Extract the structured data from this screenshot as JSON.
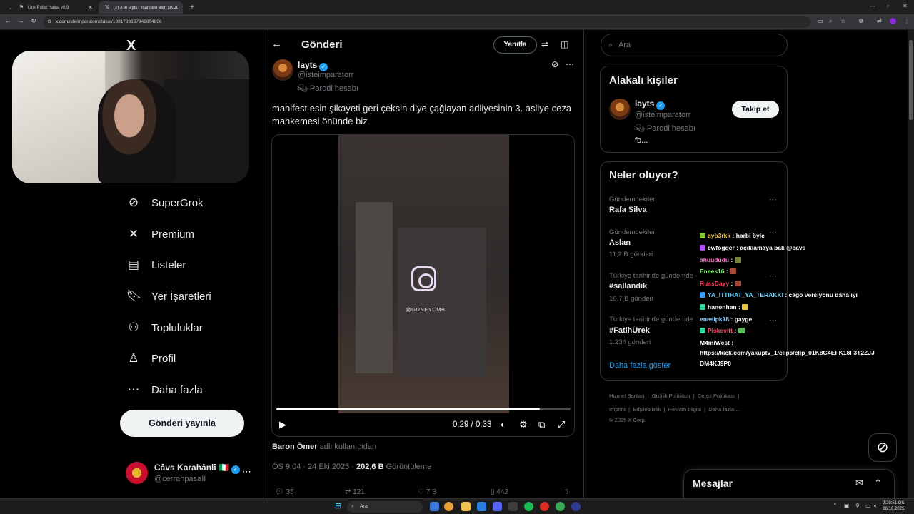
{
  "browser": {
    "tabs": [
      {
        "title": "Link Polisi Hakat v0.9",
        "active": false
      },
      {
        "title": "(2) X'te layts: \"manifest esin şik...",
        "active": true
      }
    ],
    "url_host": "x.com",
    "url_path": "/isteimparatorr/status/1981783837949804806"
  },
  "nav": {
    "logo": "X",
    "items": [
      {
        "label": "SuperGrok",
        "icon": "grok-icon"
      },
      {
        "label": "Premium",
        "icon": "x-logo-icon"
      },
      {
        "label": "Listeler",
        "icon": "list-icon"
      },
      {
        "label": "Yer İşaretleri",
        "icon": "bookmark-icon"
      },
      {
        "label": "Topluluklar",
        "icon": "communities-icon"
      },
      {
        "label": "Profil",
        "icon": "profile-icon"
      },
      {
        "label": "Daha fazla",
        "icon": "more-circle-icon"
      }
    ],
    "post_button": "Gönderi yayınla",
    "account": {
      "name": "Câvs Karahânlî 🇮🇹",
      "handle": "@cerrahpasaII"
    }
  },
  "header": {
    "title": "Gönderi",
    "reply_button": "Yanıtla"
  },
  "tweet": {
    "author_name": "layts",
    "author_handle": "@isteimparatorr",
    "parody_label": "Parodi hesabı",
    "text": "manifest esin şikayeti geri çeksin diye çağlayan adliyesinin 3. asliye ceza mahkemesi önünde biz",
    "video": {
      "watermark": "@GUNEYCMB",
      "current_time": "0:29",
      "duration": "0:33",
      "progress_percent": 89.5,
      "time_separator": "/"
    },
    "from_user_name": "Baron Ömer",
    "from_user_suffix": "adlı kullanıcıdan",
    "timestamp": "ÖS 9:04 · 24 Eki 2025 ·",
    "views_count": "202,6 B",
    "views_label": "Görüntüleme",
    "actions": {
      "replies": "35",
      "reposts": "121",
      "likes": "7 B",
      "bookmarks": "442"
    }
  },
  "right": {
    "search_placeholder": "Ara",
    "related_title": "Alakalı kişiler",
    "related_person": {
      "name": "layts",
      "handle": "@isteimparatorr",
      "parody_label": "Parodi hesabı",
      "bio": "fb...",
      "follow_button": "Takip et"
    },
    "trends_title": "Neler oluyor?",
    "trends": [
      {
        "category": "Gündemdekiler",
        "name": "Rafa Silva",
        "count": ""
      },
      {
        "category": "Gündemdekiler",
        "name": "Aslan",
        "count": "11,2 B gönderi"
      },
      {
        "category": "Türkiye tarihinde gündemde",
        "name": "#sallandık",
        "count": "10,7 B gönderi"
      },
      {
        "category": "Türkiye tarihinde gündemde",
        "name": "#FatihÜrek",
        "count": "1.234 gönderi"
      }
    ],
    "show_more": "Daha fazla göster",
    "footer_row1": [
      "Hizmet Şartları",
      "Gizlilik Politikası",
      "Çerez Politikası"
    ],
    "footer_row2": [
      "Imprint",
      "Erişilebilirlik",
      "Reklam bilgisi",
      "Daha fazla ..."
    ],
    "copyright": "© 2025 X Corp."
  },
  "chat": [
    {
      "user": "ayb3rkk",
      "color": "#f4c542",
      "msg": ": harbi öyle"
    },
    {
      "user": "ewfogqer",
      "color": "#ffffff",
      "msg": ": açıklamaya bak @cavs"
    },
    {
      "user": "ahuududu",
      "color": "#ff77c8",
      "msg": ":"
    },
    {
      "user": "Enees16",
      "color": "#7dff6a",
      "msg": ":"
    },
    {
      "user": "RussDayy",
      "color": "#ff3b5c",
      "msg": ":"
    },
    {
      "user": "YA_ITTIHAT_YA_TERAKKI",
      "color": "#6fd1ff",
      "msg": ": cago versiyonu daha iyi"
    },
    {
      "user": "hanonhan",
      "color": "#ffffff",
      "msg": ":"
    },
    {
      "user": "enesipk18",
      "color": "#8fd0ff",
      "msg": ": gayge"
    },
    {
      "user": "Piskevitt",
      "color": "#ff4d6d",
      "msg": ":"
    },
    {
      "user": "M4miWest",
      "color": "#ffffff",
      "msg": ":"
    }
  ],
  "chat_link_1": "https://kick.com/yakuptv_1/clips/clip_01K8G4EFK18F3T2ZJJ",
  "chat_link_2": "DM4KJ9P0",
  "messages_title": "Mesajlar",
  "taskbar": {
    "search": "Ara",
    "time": "2:29:51 ÖS",
    "date": "26.10.2025"
  }
}
